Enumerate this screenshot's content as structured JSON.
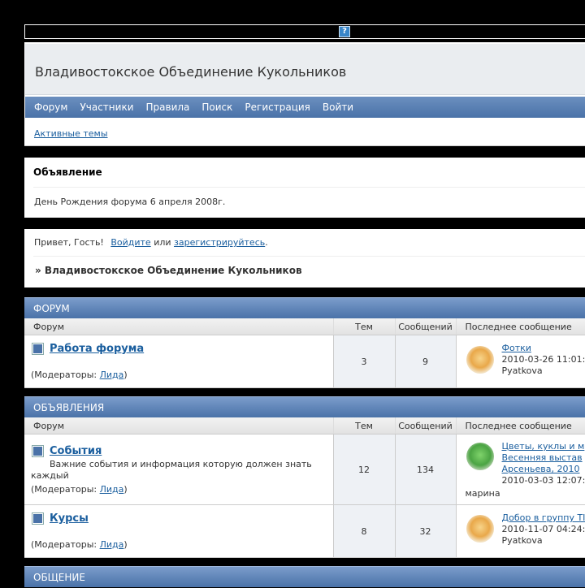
{
  "site": {
    "title": "Владивостокское Объединение Кукольников",
    "help_icon": "?"
  },
  "nav": {
    "items": [
      {
        "label": "Форум"
      },
      {
        "label": "Участники"
      },
      {
        "label": "Правила"
      },
      {
        "label": "Поиск"
      },
      {
        "label": "Регистрация"
      },
      {
        "label": "Войти"
      }
    ]
  },
  "subnav": {
    "active_topics": "Активные темы"
  },
  "announcement": {
    "heading": "Объявление",
    "body": "День Рождения форума 6 апреля 2008г."
  },
  "welcome": {
    "greeting": "Привет, Гость!",
    "login": "Войдите",
    "or": " или ",
    "register": "зарегистрируйтесь",
    "period": ".",
    "breadcrumb": "» Владивостокское Объединение Кукольников"
  },
  "columns": {
    "forum": "Форум",
    "topics": "Тем",
    "posts": "Сообщений",
    "last": "Последнее сообщение"
  },
  "moderators_label": "(Модераторы: ",
  "moderator_close": ")",
  "categories": [
    {
      "name": "ФОРУМ",
      "forums": [
        {
          "name": "Работа форума",
          "desc": "",
          "moderator": "Лида",
          "topics": "3",
          "posts": "9",
          "last_title": "Фотки",
          "last_title2": "",
          "last_title3": "",
          "last_date": "2010-03-26 11:01:",
          "last_user": "Pyatkova",
          "avatar": "bear"
        }
      ]
    },
    {
      "name": "ОБЪЯВЛЕНИЯ",
      "forums": [
        {
          "name": "События",
          "desc": "Важние события и информация которую должен знать каждый",
          "moderator": "Лида",
          "topics": "12",
          "posts": "134",
          "last_title": "Цветы, куклы и м",
          "last_title2": "Весенняя выстав",
          "last_title3": "Арсеньева, 2010",
          "last_date": "2010-03-03 12:07:",
          "last_user": "марина",
          "avatar": "green"
        },
        {
          "name": "Курсы",
          "desc": "",
          "moderator": "Лида",
          "topics": "8",
          "posts": "32",
          "last_title": "Добор в группу ТІ",
          "last_title2": "",
          "last_title3": "",
          "last_date": "2010-11-07 04:24:",
          "last_user": "Pyatkova",
          "avatar": "bear"
        }
      ]
    },
    {
      "name": "ОБЩЕНИЕ",
      "forums": []
    }
  ]
}
